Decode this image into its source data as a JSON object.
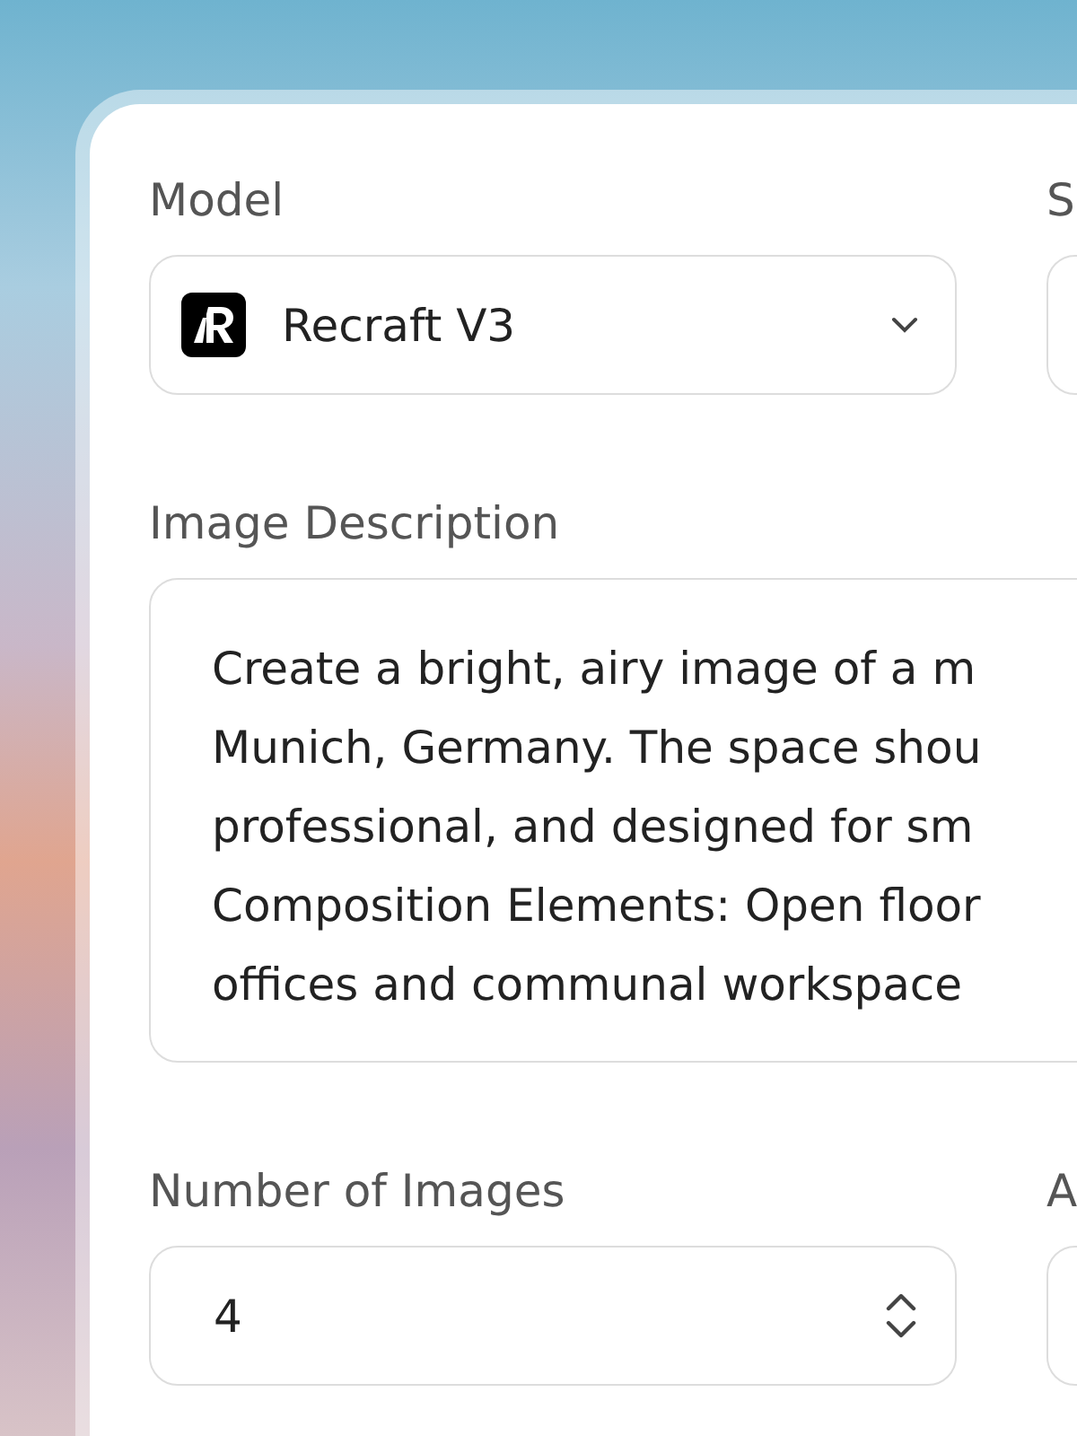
{
  "model": {
    "label": "Model",
    "value": "Recraft V3"
  },
  "field_2": {
    "label": "S"
  },
  "description": {
    "label": "Image Description",
    "lines": [
      "Create a bright, airy image of a m",
      "Munich, Germany. The space shou",
      "professional, and designed for sm",
      "Composition Elements: Open floor",
      "offices and communal workspace"
    ]
  },
  "number_of_images": {
    "label": "Number of Images",
    "value": "4"
  },
  "field_4": {
    "label": "A"
  }
}
